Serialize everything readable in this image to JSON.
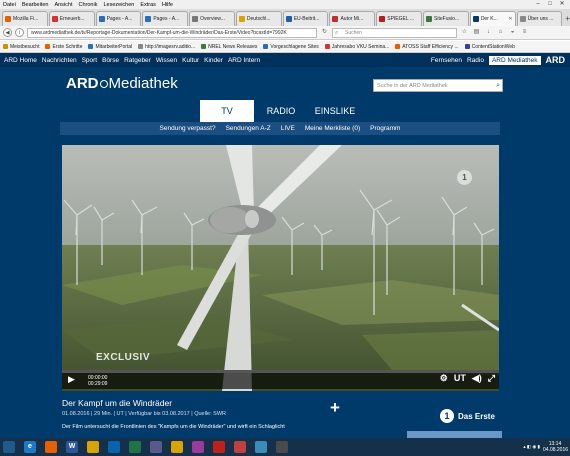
{
  "menubar": {
    "items": [
      "Datei",
      "Bearbeiten",
      "Ansicht",
      "Chronik",
      "Lesezeichen",
      "Extras",
      "Hilfe"
    ]
  },
  "tabs": [
    {
      "label": "Mozilla Fi...",
      "color": "#e66000"
    },
    {
      "label": "Erneuerb...",
      "color": "#d93030"
    },
    {
      "label": "Pages - A...",
      "color": "#2a6fb5"
    },
    {
      "label": "Pages - A...",
      "color": "#2a6fb5"
    },
    {
      "label": "Overview...",
      "color": "#777777"
    },
    {
      "label": "Deutschl...",
      "color": "#d9a400"
    },
    {
      "label": "EU-Beitrit...",
      "color": "#1f5fa8"
    },
    {
      "label": "Autor Mi...",
      "color": "#c03030"
    },
    {
      "label": "SPIEGEL ...",
      "color": "#b81b1b"
    },
    {
      "label": "SiteFusio...",
      "color": "#3a7a3a"
    },
    {
      "label": "Der K...",
      "color": "#003a6b",
      "active": true
    },
    {
      "label": "Über uns ...",
      "color": "#888888"
    }
  ],
  "urlbar": {
    "url": "www.ardmediathek.de/tv/Reportage-Dokumentation/Der-Kampf-um-die-Windräder/Das-Erste/Video?bcastId=7992K",
    "search_placeholder": "Suchen"
  },
  "bookmarks": [
    {
      "label": "Meistbesucht",
      "color": "#d09000"
    },
    {
      "label": "Erste Schritte",
      "color": "#e66000"
    },
    {
      "label": "MitarbeiterPortal",
      "color": "#2a6fb5"
    },
    {
      "label": "http://imagesrv.aditio...",
      "color": "#888888"
    },
    {
      "label": "NREL News Releases",
      "color": "#3a7a3a"
    },
    {
      "label": "Vorgeschlagene Sites",
      "color": "#2a6fb5"
    },
    {
      "label": "Jahresabo VKU Semina...",
      "color": "#d93030"
    },
    {
      "label": "ATOSS Staff Efficiency ...",
      "color": "#e66000"
    },
    {
      "label": "ContentStationWeb",
      "color": "#3a3a9a"
    }
  ],
  "topnav": {
    "left": [
      "ARD Home",
      "Nachrichten",
      "Sport",
      "Börse",
      "Ratgeber",
      "Wissen",
      "Kultur",
      "Kinder",
      "ARD Intern"
    ],
    "right": [
      "Fernsehen",
      "Radio"
    ],
    "active": "ARD Mediathek",
    "badge": "ARD"
  },
  "header": {
    "logo_ard": "ARD",
    "logo_rest": "Mediathek",
    "search_placeholder": "Suche in der ARD Mediathek"
  },
  "channel_tabs": [
    "TV",
    "RADIO",
    "EINSLIKE"
  ],
  "subnav": [
    "Sendung verpasst?",
    "Sendungen A-Z",
    "LIVE",
    "Meine Merkliste (0)",
    "Programm"
  ],
  "player": {
    "overlay_text": "EXCLUSIV",
    "watermark": "1",
    "time_current": "00:00:00",
    "time_total": "00:29:09",
    "subtitle_button": "UT",
    "progress": 0
  },
  "video": {
    "title": "Der Kampf um die Windräder",
    "meta": "01.08.2016 | 29 Min. | UT | Verfügbar bis 03.08.2017 | Quelle: SWR",
    "description": "Der Film untersucht die Frontlinien des \"Kampfs um die Windräder\" und wirft ein Schlaglicht",
    "channel": "Das Erste",
    "channel_number": "1"
  },
  "taskbar": {
    "apps": [
      {
        "name": "start",
        "label": "",
        "color": "#1e5a8a"
      },
      {
        "name": "ie",
        "label": "e",
        "color": "#1e78c8"
      },
      {
        "name": "firefox",
        "label": "",
        "color": "#e66000"
      },
      {
        "name": "word",
        "label": "W",
        "color": "#2b579a"
      },
      {
        "name": "explorer",
        "label": "",
        "color": "#d9a400"
      },
      {
        "name": "outlook",
        "label": "",
        "color": "#0a64ad"
      },
      {
        "name": "excel",
        "label": "",
        "color": "#217346"
      },
      {
        "name": "app7",
        "label": "",
        "color": "#5a5a8a"
      },
      {
        "name": "app8",
        "label": "",
        "color": "#d9a400"
      },
      {
        "name": "app9",
        "label": "",
        "color": "#9a3a9a"
      },
      {
        "name": "acrobat",
        "label": "",
        "color": "#c0201a"
      },
      {
        "name": "app11",
        "label": "",
        "color": "#c04040"
      },
      {
        "name": "app12",
        "label": "",
        "color": "#3a8aba"
      },
      {
        "name": "app13",
        "label": "",
        "color": "#4a4a4a"
      }
    ],
    "time": "13:14",
    "date": "04.08.2016"
  }
}
